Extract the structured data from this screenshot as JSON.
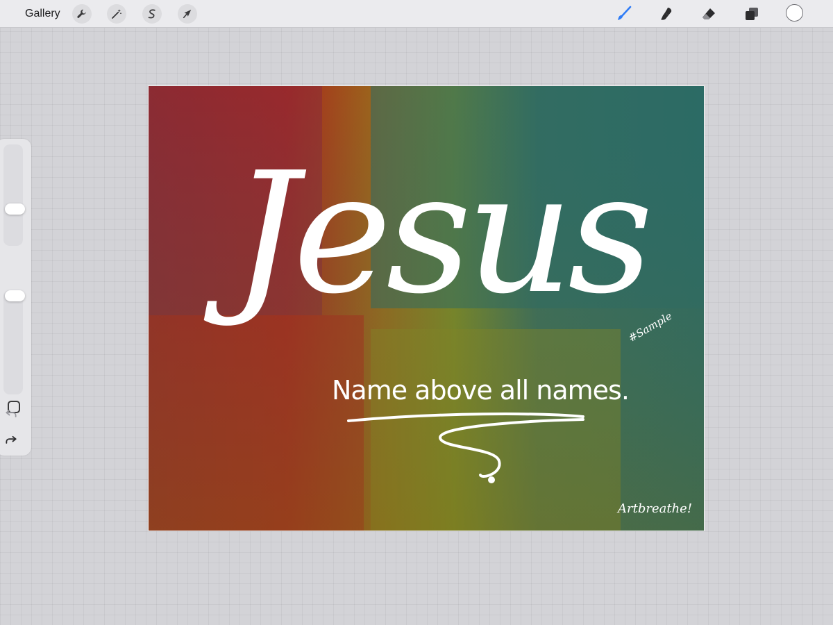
{
  "app": {
    "gallery_label": "Gallery",
    "left_tools": [
      {
        "name": "actions",
        "icon": "wrench-icon"
      },
      {
        "name": "adjustments",
        "icon": "magic-wand-icon"
      },
      {
        "name": "selection",
        "icon": "selection-s-icon"
      },
      {
        "name": "transform",
        "icon": "arrow-cursor-icon"
      }
    ],
    "right_tools": [
      {
        "name": "brush",
        "icon": "brush-icon",
        "active": true
      },
      {
        "name": "smudge",
        "icon": "smudge-icon",
        "active": false
      },
      {
        "name": "eraser",
        "icon": "eraser-icon",
        "active": false
      },
      {
        "name": "layers",
        "icon": "layers-icon",
        "active": false
      }
    ],
    "current_color": "#ffffff",
    "accent_color": "#2f7cf6"
  },
  "sidebar": {
    "brush_size_level": 0.35,
    "opacity_level": 0.0,
    "modify_icon": "square-outline-icon",
    "undo_icon": "undo-icon",
    "redo_icon": "redo-icon"
  },
  "canvas": {
    "title_word": "Jesus",
    "subtitle": "Name above all names.",
    "watermark": "#Sample",
    "signature": "Artbreathe!",
    "palette": {
      "left": "#a8231a",
      "middle": "#9a8a22",
      "right": "#2f6b62"
    }
  }
}
